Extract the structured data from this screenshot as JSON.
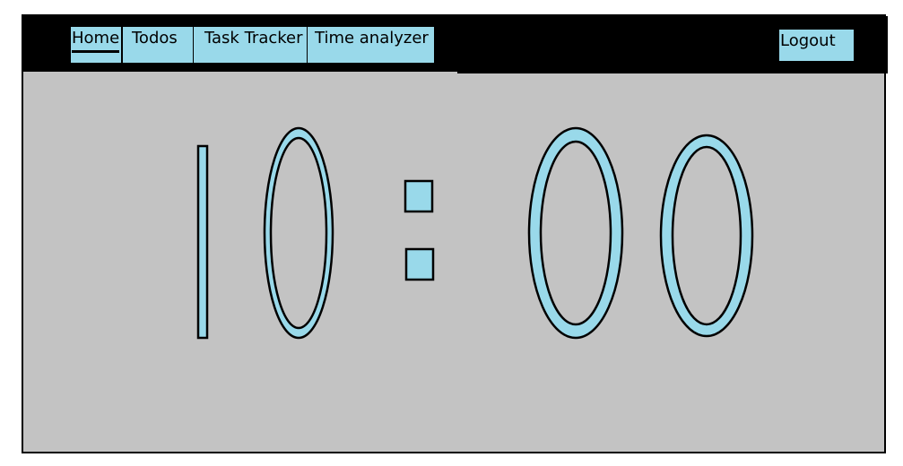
{
  "nav": {
    "items": [
      {
        "label": "Home",
        "active": true
      },
      {
        "label": "Todos"
      },
      {
        "label": "Task Tracker"
      },
      {
        "label": "Time analyzer"
      }
    ],
    "logout_label": "Logout"
  },
  "clock": {
    "time": "10:00"
  },
  "colors": {
    "accent": "#99d9ea",
    "background": "#c3c3c3",
    "navbar": "#000000"
  }
}
